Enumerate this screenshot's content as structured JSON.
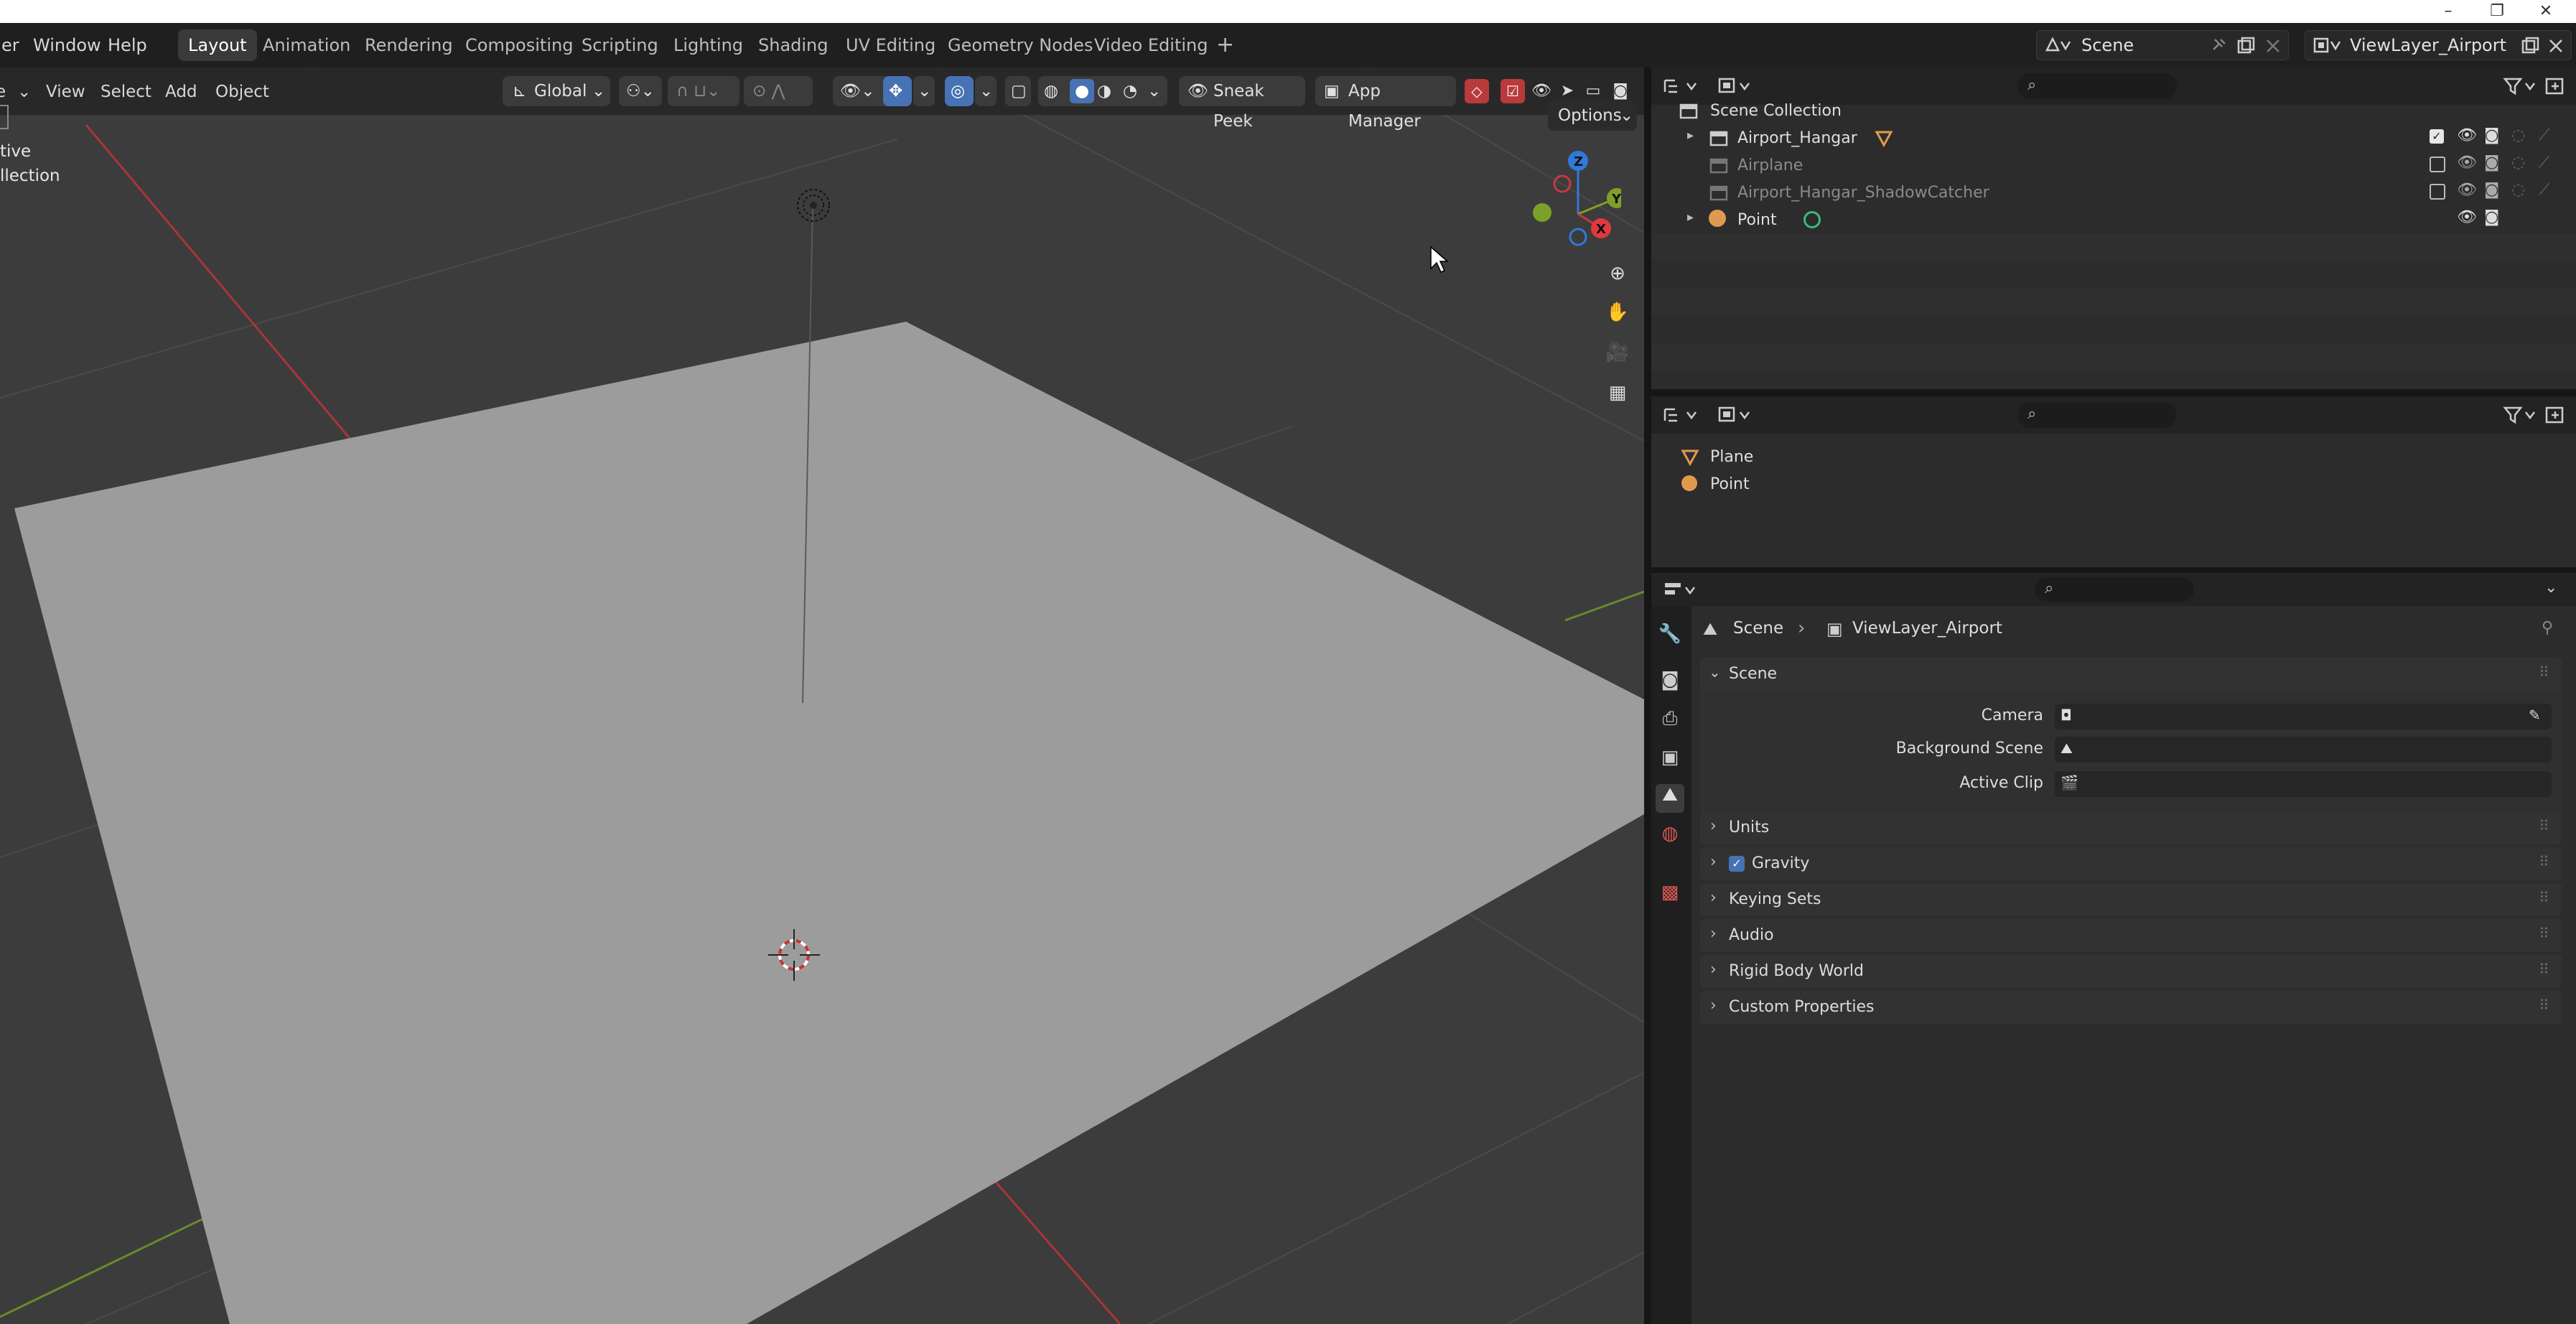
{
  "window": {
    "minimize": "–",
    "maximize": "❐",
    "close": "✕"
  },
  "menubar": {
    "items": [
      "er",
      "Window",
      "Help"
    ]
  },
  "workspaces": {
    "tabs": [
      "Layout",
      "Animation",
      "Rendering",
      "Compositing",
      "Scripting",
      "Lighting",
      "Shading",
      "UV Editing",
      "Geometry Nodes",
      "Video Editing"
    ],
    "active": "Layout",
    "add": "+"
  },
  "scene_selector": {
    "value": "Scene"
  },
  "viewlayer_selector": {
    "value": "ViewLayer_Airport"
  },
  "viewport": {
    "menus": [
      "e",
      "View",
      "Select",
      "Add",
      "Object"
    ],
    "orientation": "Global",
    "sneak_peek": "Sneak Peek",
    "app_manager": "App Manager",
    "options": "Options",
    "overlay_text": [
      "tive",
      "llection"
    ],
    "gizmo": {
      "z": "Z",
      "y": "Y",
      "x": "X"
    },
    "colors": {
      "x_axis": "#c8383e",
      "y_axis": "#7ca128",
      "z_axis": "#2f7ad8",
      "plane": "#9c9c9c",
      "accent": "#4772b3"
    }
  },
  "outliner_top": {
    "root": "Scene Collection",
    "items": [
      {
        "label": "Airport_Hangar",
        "visible": true,
        "enabled": true
      },
      {
        "label": "Airplane",
        "visible": true,
        "enabled": false
      },
      {
        "label": "Airport_Hangar_ShadowCatcher",
        "visible": true,
        "enabled": false
      },
      {
        "label": "Point",
        "visible": true,
        "enabled": true
      }
    ]
  },
  "outliner_bottom": {
    "items": [
      "Plane",
      "Point"
    ]
  },
  "properties": {
    "breadcrumb": {
      "scene": "Scene",
      "layer": "ViewLayer_Airport"
    },
    "scene_panel": {
      "title": "Scene",
      "camera_label": "Camera",
      "background_label": "Background Scene",
      "clip_label": "Active Clip"
    },
    "sections": [
      "Units",
      "Gravity",
      "Keying Sets",
      "Audio",
      "Rigid Body World",
      "Custom Properties"
    ],
    "gravity_checked": true
  }
}
